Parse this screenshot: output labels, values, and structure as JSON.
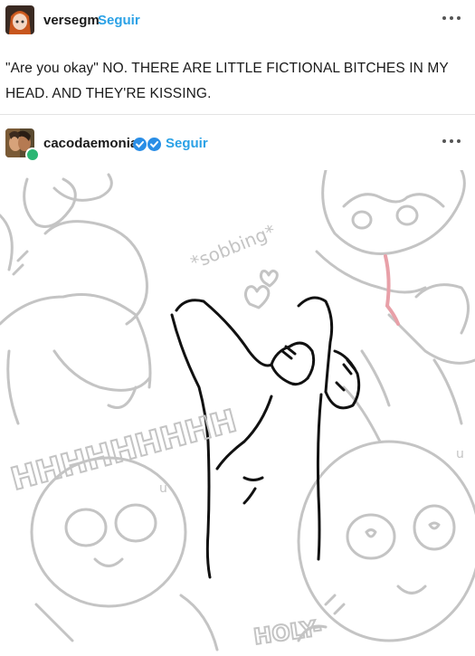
{
  "post1": {
    "username": "versegm",
    "follow_label": "Seguir",
    "more_icon": "ellipsis-icon",
    "text_line1": "\"Are you okay\" NO. THERE ARE LITTLE FICTIONAL BITCHES IN MY",
    "text_line2": "HEAD. AND THEY'RE KISSING."
  },
  "post2": {
    "username": "cacodaemonia",
    "follow_label": "Seguir",
    "more_icon": "ellipsis-icon",
    "badges": [
      "verified-badge-icon",
      "verified-badge-icon"
    ],
    "reblog_badge": "reblog-icon"
  },
  "drawing": {
    "text_sobbing": "*sobbing*",
    "text_scream": "HHHHHHHHH",
    "text_holy": "HOLY-",
    "text_u1": "u",
    "text_u2": "u"
  },
  "colors": {
    "follow": "#2aa1e6",
    "verified": "#2a8ee6",
    "reblog": "#2bb673",
    "sketch_gray": "#c4c4c4",
    "blush": "#e8a0a8"
  }
}
